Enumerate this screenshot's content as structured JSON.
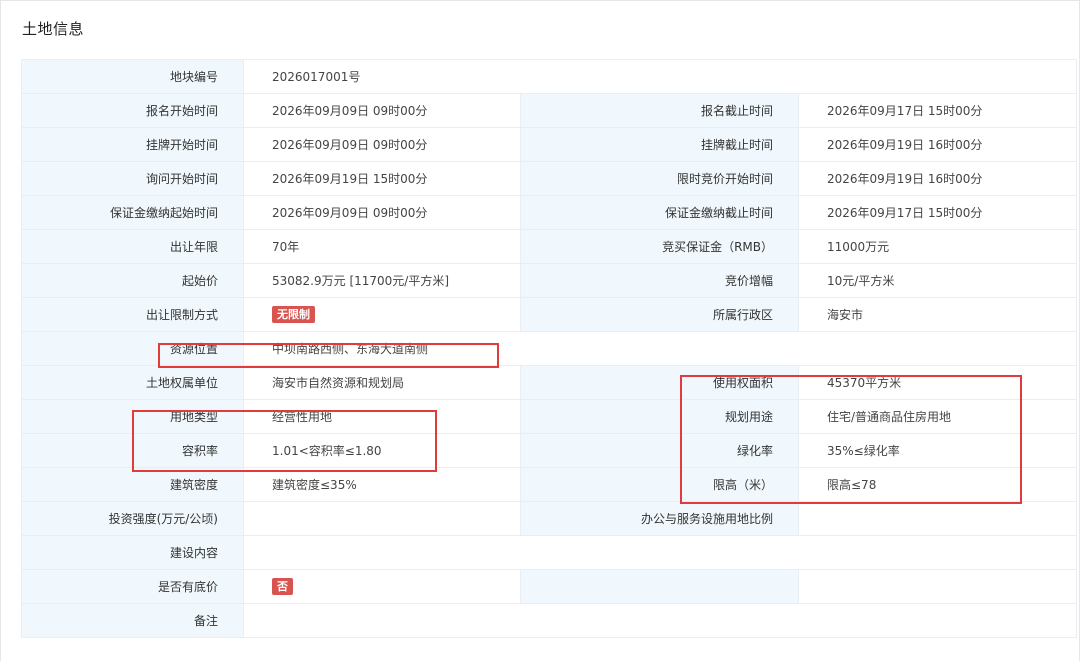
{
  "section": {
    "title": "土地信息"
  },
  "rows": {
    "parcel_no": {
      "label": "地块编号",
      "value": "2026017001号"
    },
    "signup_start": {
      "label": "报名开始时间",
      "value": "2026年09月09日 09时00分"
    },
    "signup_end": {
      "label": "报名截止时间",
      "value": "2026年09月17日 15时00分"
    },
    "listing_start": {
      "label": "挂牌开始时间",
      "value": "2026年09月09日 09时00分"
    },
    "listing_end": {
      "label": "挂牌截止时间",
      "value": "2026年09月19日 16时00分"
    },
    "inquiry_start": {
      "label": "询问开始时间",
      "value": "2026年09月19日 15时00分"
    },
    "timed_bid_start": {
      "label": "限时竞价开始时间",
      "value": "2026年09月19日 16时00分"
    },
    "deposit_start": {
      "label": "保证金缴纳起始时间",
      "value": "2026年09月09日 09时00分"
    },
    "deposit_end": {
      "label": "保证金缴纳截止时间",
      "value": "2026年09月17日 15时00分"
    },
    "term": {
      "label": "出让年限",
      "value": "70年"
    },
    "bid_deposit": {
      "label": "竞买保证金（RMB）",
      "value": "11000万元"
    },
    "start_price": {
      "label": "起始价",
      "value": "53082.9万元 [11700元/平方米]"
    },
    "bid_increment": {
      "label": "竞价增幅",
      "value": "10元/平方米"
    },
    "restriction": {
      "label": "出让限制方式",
      "badge": "无限制"
    },
    "district": {
      "label": "所属行政区",
      "value": "海安市"
    },
    "location": {
      "label": "资源位置",
      "value": "中坝南路西侧、东海大道南侧"
    },
    "owner": {
      "label": "土地权属单位",
      "value": "海安市自然资源和规划局"
    },
    "area": {
      "label": "使用权面积",
      "value": "45370平方米"
    },
    "land_type": {
      "label": "用地类型",
      "value": "经营性用地"
    },
    "planned_use": {
      "label": "规划用途",
      "value": "住宅/普通商品住房用地"
    },
    "far": {
      "label": "容积率",
      "value": "1.01<容积率≤1.80"
    },
    "green_rate": {
      "label": "绿化率",
      "value": "35%≤绿化率"
    },
    "density": {
      "label": "建筑密度",
      "value": "建筑密度≤35%"
    },
    "height_limit": {
      "label": "限高（米）",
      "value": "限高≤78"
    },
    "investment": {
      "label": "投资强度(万元/公顷)",
      "value": ""
    },
    "office_ratio": {
      "label": "办公与服务设施用地比例",
      "value": ""
    },
    "construction": {
      "label": "建设内容",
      "value": ""
    },
    "reserve_price": {
      "label": "是否有底价",
      "badge": "否"
    },
    "remarks": {
      "label": "备注",
      "value": ""
    }
  },
  "colors": {
    "label_bg": "#f0f8fd",
    "border": "#e8eef3",
    "badge": "#d9534f",
    "highlight": "#e23b3b"
  }
}
